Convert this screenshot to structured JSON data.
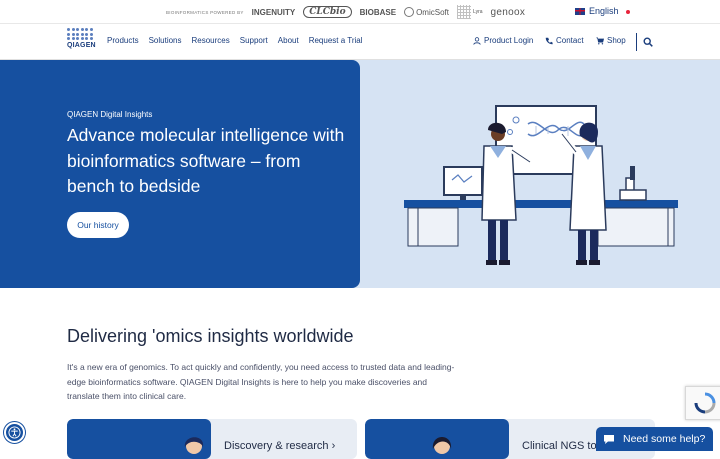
{
  "topbar": {
    "powered_label": "BIOINFORMATICS POWERED BY",
    "brands": [
      "INGENUITY",
      "CLCbio",
      "BIOBASE",
      "OmicSoft",
      "Lyra",
      "genoox"
    ],
    "language": "English"
  },
  "nav": {
    "logo_text": "QIAGEN",
    "menu": [
      "Products",
      "Solutions",
      "Resources",
      "Support",
      "About",
      "Request a Trial"
    ],
    "product_login": "Product Login",
    "contact": "Contact",
    "shop": "Shop"
  },
  "hero": {
    "eyebrow": "QIAGEN Digital Insights",
    "headline": "Advance molecular intelligence with bioinformatics software – from bench to bedside",
    "button": "Our history"
  },
  "section": {
    "title": "Delivering 'omics insights worldwide",
    "body": "It's a new era of genomics. To act quickly and confidently, you need access to trusted data and leading-edge bioinformatics software. QIAGEN Digital Insights is here to help you make discoveries and translate them into clinical care."
  },
  "cards": [
    {
      "label": "Discovery & research"
    },
    {
      "label": "Clinical NGS to"
    }
  ],
  "chat": {
    "label": "Need some help?"
  },
  "colors": {
    "brand_blue": "#1650a0",
    "hero_bg": "#d6e3f3",
    "nav_text": "#1a3d7c"
  }
}
